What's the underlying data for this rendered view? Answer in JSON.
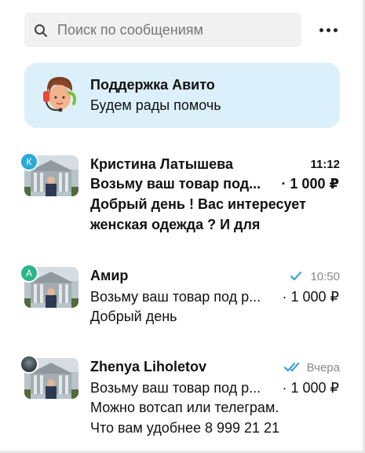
{
  "search": {
    "placeholder": "Поиск по сообщениям",
    "icon": "search-icon"
  },
  "menu": {
    "icon": "more-dots-icon"
  },
  "support": {
    "title": "Поддержка Авито",
    "subtitle": "Будем рады помочь",
    "icon": "support-agent-icon",
    "background": "#dcf0fb"
  },
  "chats": [
    {
      "badge_letter": "К",
      "badge_color": "#2aa9d6",
      "name": "Кристина Латышева",
      "time": "11:12",
      "topic": "Возьму ваш товар под...",
      "price": "· 1 000 ₽",
      "message_lines": [
        "Добрый день ! Вас интересует",
        "женская одежда ? И для"
      ],
      "unread": true
    },
    {
      "badge_letter": "А",
      "badge_color": "#2bb58a",
      "name": "Амир",
      "time": "10:50",
      "status_icon": "single-check-icon",
      "topic": "Возьму ваш товар под р...",
      "price": "· 1 000 ₽",
      "message_lines": [
        "Добрый день"
      ],
      "unread": false
    },
    {
      "badge_letter": "",
      "badge_color": "#2d3a3f",
      "name": "Zhenya Liholetov",
      "time": "Вчера",
      "status_icon": "double-check-icon",
      "topic": "Возьму ваш товар под р...",
      "price": "· 1 000 ₽",
      "message_lines": [
        "Можно вотсап или телеграм.",
        "Что вам удобнее 8 999 21 21"
      ],
      "unread": false
    }
  ],
  "colors": {
    "accent": "#2a9cd6",
    "muted": "#8a8a8a"
  }
}
